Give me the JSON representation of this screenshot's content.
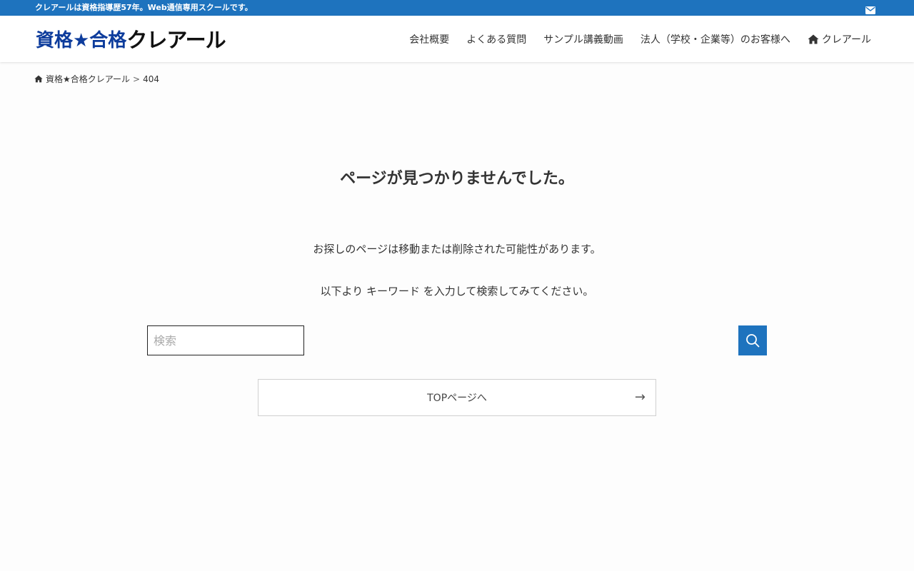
{
  "topbar": {
    "tagline": "クレアールは資格指導歴57年。Web通信専用スクールです。",
    "mail_icon": "mail-icon",
    "bg_color": "#1e73be"
  },
  "header": {
    "logo_part1": "資格★合格",
    "logo_part2": "クレアール",
    "logo_colors": {
      "part1": "#0d3c9c",
      "part2": "#111111"
    },
    "nav": [
      {
        "label": "会社概要"
      },
      {
        "label": "よくある質問"
      },
      {
        "label": "サンプル講義動画"
      },
      {
        "label": "法人（学校・企業等）のお客様へ"
      },
      {
        "label": "クレアール",
        "icon": "home-icon"
      }
    ]
  },
  "breadcrumb": {
    "home_label": "資格★合格クレアール",
    "separator": ">",
    "current": "404"
  },
  "main": {
    "title": "ページが見つかりませんでした。",
    "message1": "お探しのページは移動または削除された可能性があります。",
    "message2": "以下より キーワード を入力して検索してみてください。",
    "search": {
      "placeholder": "検索",
      "value": "",
      "button_icon": "search-icon"
    },
    "top_button": {
      "label": "TOPページへ",
      "arrow": "→"
    }
  }
}
